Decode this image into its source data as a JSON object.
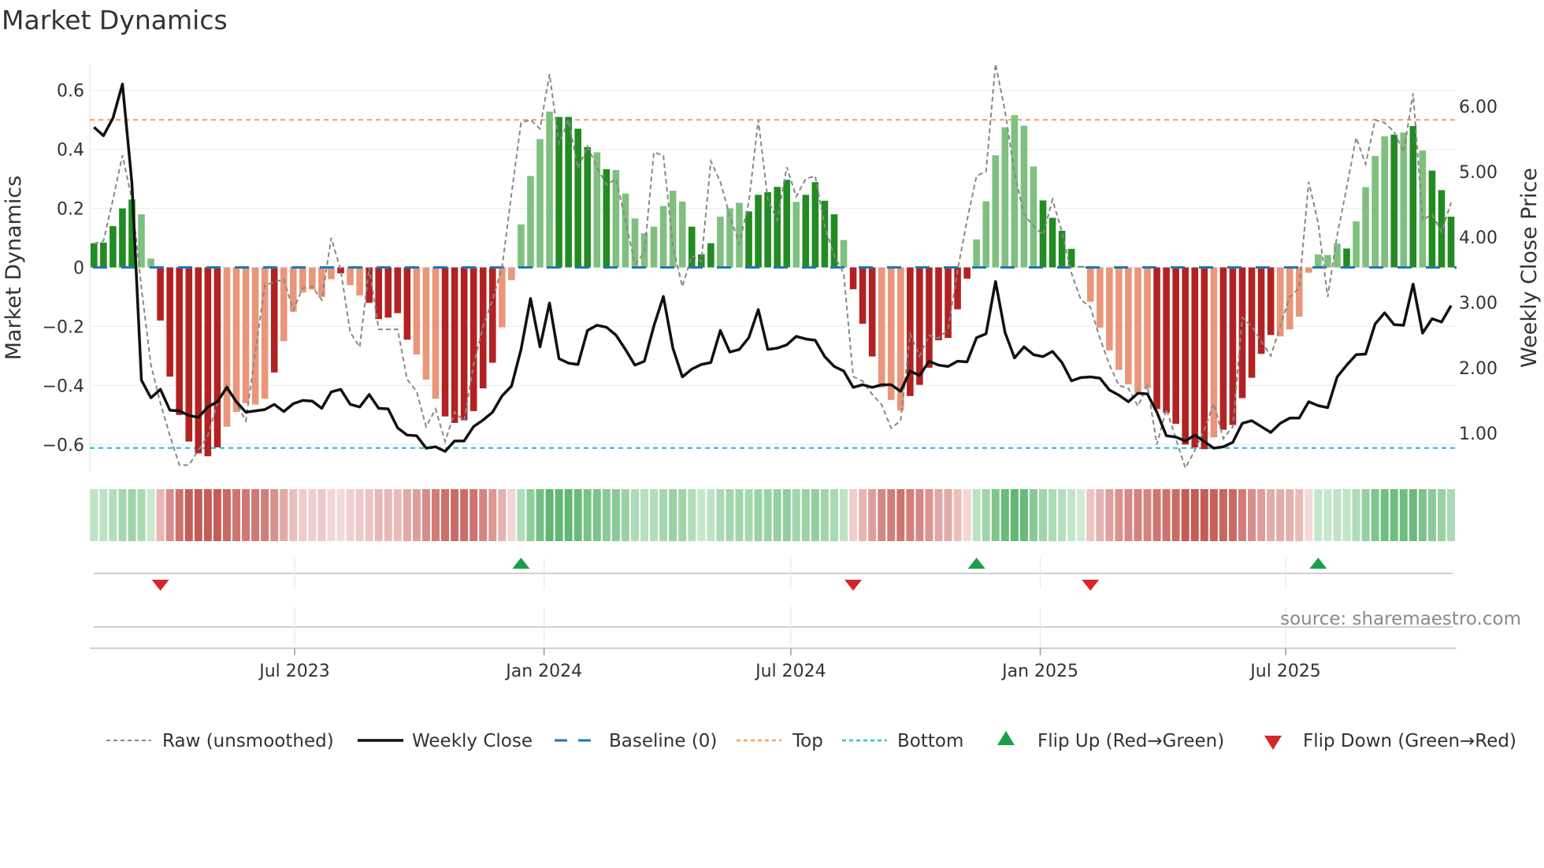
{
  "title": "Market Dynamics",
  "source": "source: sharemaestro.com",
  "colors": {
    "green_dark": "#228b22",
    "green_light": "#7fc07f",
    "red_dark": "#b22222",
    "red_light": "#e9967a",
    "close_line": "#111111",
    "raw_line": "#888888",
    "baseline": "#1f77b4",
    "top": "#f4a460",
    "bottom": "#2ec4d6",
    "flip_up": "#1a9e4a",
    "flip_down": "#d62728"
  },
  "legend": [
    {
      "label": "Raw (unsmoothed)"
    },
    {
      "label": "Weekly Close"
    },
    {
      "label": "Baseline (0)"
    },
    {
      "label": "Top"
    },
    {
      "label": "Bottom"
    },
    {
      "label": "Flip Up (Red→Green)"
    },
    {
      "label": "Flip Down (Green→Red)"
    }
  ],
  "chart_data": {
    "type": "bar",
    "title": "Market Dynamics",
    "ylabel": "Market Dynamics",
    "ylabel_right": "Weekly Close Price",
    "x_start": "2023-02-03",
    "x_step_days": 7,
    "ylim": [
      -0.69,
      0.69
    ],
    "ylim_right": [
      0.42,
      6.65
    ],
    "yticks": [
      {
        "v": 0.6,
        "label": "0.6"
      },
      {
        "v": 0.4,
        "label": "0.4"
      },
      {
        "v": 0.2,
        "label": "0.2"
      },
      {
        "v": 0,
        "label": "0"
      },
      {
        "v": -0.2,
        "label": "−0.2"
      },
      {
        "v": -0.4,
        "label": "−0.4"
      },
      {
        "v": -0.6,
        "label": "−0.6"
      }
    ],
    "yticks_right": [
      {
        "v": 6,
        "label": "6.00"
      },
      {
        "v": 5,
        "label": "5.00"
      },
      {
        "v": 4,
        "label": "4.00"
      },
      {
        "v": 3,
        "label": "3.00"
      },
      {
        "v": 2,
        "label": "2.00"
      },
      {
        "v": 1,
        "label": "1.00"
      }
    ],
    "xticks": [
      {
        "date": "2023-07-01",
        "label": "Jul 2023"
      },
      {
        "date": "2024-01-01",
        "label": "Jan 2024"
      },
      {
        "date": "2024-07-01",
        "label": "Jul 2024"
      },
      {
        "date": "2025-01-01",
        "label": "Jan 2025"
      },
      {
        "date": "2025-07-01",
        "label": "Jul 2025"
      }
    ],
    "grid": true,
    "legend_position": "bottom",
    "baseline": 0,
    "top": 0.5,
    "bottom": -0.612,
    "values": [
      0.082,
      0.084,
      0.14,
      0.2,
      0.23,
      0.18,
      0.03,
      -0.18,
      -0.37,
      -0.5,
      -0.59,
      -0.63,
      -0.64,
      -0.61,
      -0.54,
      -0.49,
      -0.46,
      -0.465,
      -0.445,
      -0.356,
      -0.25,
      -0.15,
      -0.085,
      -0.075,
      -0.1,
      -0.04,
      -0.02,
      -0.06,
      -0.095,
      -0.12,
      -0.175,
      -0.17,
      -0.155,
      -0.245,
      -0.295,
      -0.38,
      -0.445,
      -0.505,
      -0.527,
      -0.518,
      -0.487,
      -0.41,
      -0.323,
      -0.203,
      -0.043,
      0.146,
      0.31,
      0.435,
      0.528,
      0.51,
      0.51,
      0.47,
      0.408,
      0.39,
      0.333,
      0.33,
      0.25,
      0.166,
      0.116,
      0.138,
      0.208,
      0.26,
      0.223,
      0.138,
      0.044,
      0.082,
      0.172,
      0.2,
      0.219,
      0.19,
      0.246,
      0.255,
      0.273,
      0.297,
      0.222,
      0.246,
      0.289,
      0.226,
      0.18,
      0.093,
      -0.074,
      -0.191,
      -0.302,
      -0.407,
      -0.449,
      -0.485,
      -0.436,
      -0.398,
      -0.34,
      -0.247,
      -0.239,
      -0.142,
      -0.038,
      0.095,
      0.224,
      0.38,
      0.475,
      0.516,
      0.48,
      0.342,
      0.227,
      0.168,
      0.124,
      0.063,
      0.004,
      -0.116,
      -0.204,
      -0.281,
      -0.347,
      -0.396,
      -0.425,
      -0.41,
      -0.48,
      -0.493,
      -0.53,
      -0.6,
      -0.61,
      -0.616,
      -0.576,
      -0.55,
      -0.534,
      -0.443,
      -0.374,
      -0.293,
      -0.229,
      -0.234,
      -0.21,
      -0.167,
      -0.018,
      0.044,
      0.042,
      0.081,
      0.064,
      0.156,
      0.272,
      0.378,
      0.444,
      0.45,
      0.457,
      0.479,
      0.396,
      0.328,
      0.262,
      0.172
    ],
    "shade": "dddddlldddddddllllldlllllldlldddddlllddddddllllllddddldlllllllldddllldddddlddddldddllldddddddllllllldddddlllllllddddddlddddddllllllldlllldldlddddddddllll",
    "raw": [
      0.08,
      0.09,
      0.23,
      0.38,
      0.23,
      -0.07,
      -0.33,
      -0.46,
      -0.57,
      -0.67,
      -0.67,
      -0.62,
      -0.57,
      -0.46,
      -0.4,
      -0.46,
      -0.52,
      -0.29,
      -0.06,
      -0.05,
      -0.04,
      -0.145,
      -0.07,
      -0.065,
      -0.11,
      0.1,
      -0.01,
      -0.22,
      -0.27,
      0.0,
      -0.21,
      -0.21,
      -0.21,
      -0.38,
      -0.42,
      -0.54,
      -0.48,
      -0.59,
      -0.49,
      -0.52,
      -0.33,
      -0.2,
      -0.11,
      0.0,
      0.25,
      0.49,
      0.5,
      0.47,
      0.655,
      0.42,
      0.5,
      0.335,
      0.41,
      0.34,
      0.28,
      0.3,
      0.16,
      0.01,
      0.05,
      0.39,
      0.38,
      0.07,
      -0.065,
      0.04,
      0.02,
      0.36,
      0.29,
      0.175,
      0.08,
      0.22,
      0.5,
      0.23,
      0.16,
      0.34,
      0.24,
      0.3,
      0.31,
      0.14,
      0.04,
      -0.02,
      -0.37,
      -0.385,
      -0.43,
      -0.465,
      -0.545,
      -0.52,
      -0.225,
      -0.3,
      -0.23,
      -0.24,
      -0.21,
      -0.01,
      0.16,
      0.31,
      0.325,
      0.69,
      0.53,
      0.32,
      0.18,
      0.14,
      0.11,
      0.23,
      0.12,
      -0.02,
      -0.11,
      -0.135,
      -0.24,
      -0.33,
      -0.4,
      -0.41,
      -0.47,
      -0.4,
      -0.6,
      -0.48,
      -0.58,
      -0.68,
      -0.62,
      -0.55,
      -0.46,
      -0.58,
      -0.54,
      -0.17,
      -0.2,
      -0.25,
      -0.3,
      -0.2,
      -0.1,
      -0.07,
      0.29,
      0.15,
      -0.1,
      0.11,
      0.27,
      0.44,
      0.35,
      0.5,
      0.49,
      0.46,
      0.39,
      0.59,
      0.16,
      0.18,
      0.12,
      0.22
    ],
    "close": [
      5.68,
      5.55,
      5.82,
      6.34,
      4.82,
      1.81,
      1.54,
      1.67,
      1.35,
      1.34,
      1.27,
      1.24,
      1.4,
      1.48,
      1.7,
      1.48,
      1.32,
      1.34,
      1.36,
      1.44,
      1.33,
      1.45,
      1.5,
      1.49,
      1.38,
      1.63,
      1.67,
      1.44,
      1.4,
      1.59,
      1.38,
      1.37,
      1.08,
      0.97,
      0.96,
      0.77,
      0.79,
      0.72,
      0.88,
      0.88,
      1.1,
      1.2,
      1.32,
      1.57,
      1.72,
      2.28,
      3.06,
      2.32,
      2.99,
      2.14,
      2.07,
      2.05,
      2.57,
      2.65,
      2.62,
      2.5,
      2.28,
      2.04,
      2.1,
      2.64,
      3.09,
      2.3,
      1.86,
      1.98,
      2.05,
      2.08,
      2.57,
      2.24,
      2.28,
      2.46,
      2.89,
      2.28,
      2.3,
      2.35,
      2.48,
      2.44,
      2.42,
      2.17,
      2.02,
      1.95,
      1.7,
      1.74,
      1.7,
      1.74,
      1.74,
      1.64,
      1.95,
      1.88,
      2.1,
      2.04,
      2.02,
      2.1,
      2.09,
      2.46,
      2.52,
      3.32,
      2.54,
      2.15,
      2.32,
      2.2,
      2.17,
      2.25,
      2.08,
      1.8,
      1.85,
      1.86,
      1.84,
      1.66,
      1.58,
      1.48,
      1.61,
      1.6,
      1.32,
      0.96,
      0.94,
      0.88,
      0.97,
      0.87,
      0.77,
      0.79,
      0.86,
      1.15,
      1.19,
      1.1,
      1.01,
      1.15,
      1.23,
      1.23,
      1.48,
      1.42,
      1.39,
      1.86,
      2.04,
      2.2,
      2.21,
      2.67,
      2.84,
      2.66,
      2.65,
      3.28,
      2.53,
      2.75,
      2.7,
      2.95
    ],
    "flips": [
      {
        "week": 8,
        "type": "down"
      },
      {
        "week": 46,
        "type": "up"
      },
      {
        "week": 81,
        "type": "down"
      },
      {
        "week": 94,
        "type": "up"
      },
      {
        "week": 106,
        "type": "down"
      },
      {
        "week": 130,
        "type": "up"
      }
    ]
  }
}
